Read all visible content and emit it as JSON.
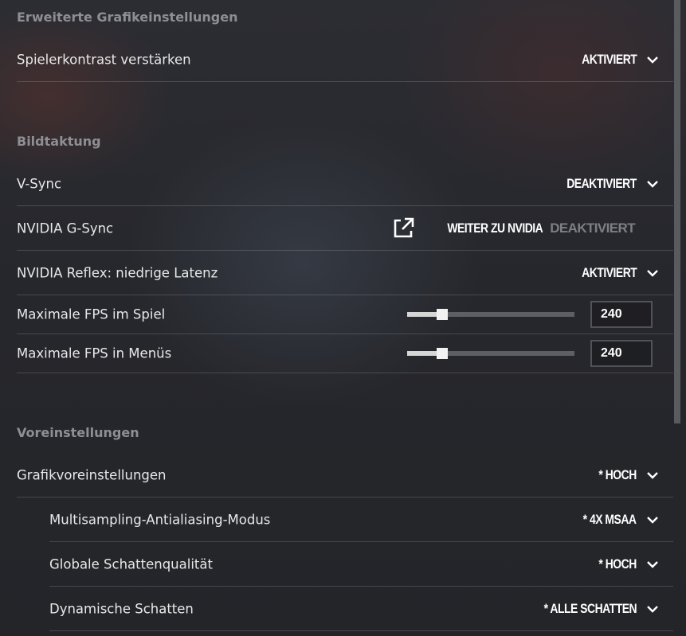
{
  "sections": {
    "advanced_graphics": {
      "title": "Erweiterte Grafikeinstellungen"
    },
    "frame_timing": {
      "title": "Bildtaktung"
    },
    "presets": {
      "title": "Voreinstellungen"
    }
  },
  "rows": {
    "player_contrast": {
      "label": "Spielerkontrast verstärken",
      "value": "AKTIVIERT"
    },
    "vsync": {
      "label": "V-Sync",
      "value": "DEAKTIVIERT"
    },
    "gsync": {
      "label": "NVIDIA G-Sync",
      "link_label": "WEITER ZU NVIDIA",
      "value": "DEAKTIVIERT"
    },
    "reflex": {
      "label": "NVIDIA Reflex: niedrige Latenz",
      "value": "AKTIVIERT"
    },
    "max_fps_game": {
      "label": "Maximale FPS im Spiel",
      "value": "240",
      "slider_fraction": 0.21
    },
    "max_fps_menu": {
      "label": "Maximale FPS in Menüs",
      "value": "240",
      "slider_fraction": 0.21
    },
    "graphics_preset": {
      "label": "Grafikvoreinstellungen",
      "value": "* HOCH"
    },
    "msaa": {
      "label": "Multisampling-Antialiasing-Modus",
      "value": "* 4X MSAA"
    },
    "shadow_quality": {
      "label": "Globale Schattenqualität",
      "value": "* HOCH"
    },
    "dynamic_shadows": {
      "label": "Dynamische Schatten",
      "value": "* ALLE SCHATTEN"
    }
  },
  "icons": {
    "dropdown": "chevron-down-icon",
    "external": "external-link-icon"
  },
  "colors": {
    "value_active": "#ffffff",
    "value_disabled": "#7d7f84",
    "section_title": "#8d8f94"
  }
}
